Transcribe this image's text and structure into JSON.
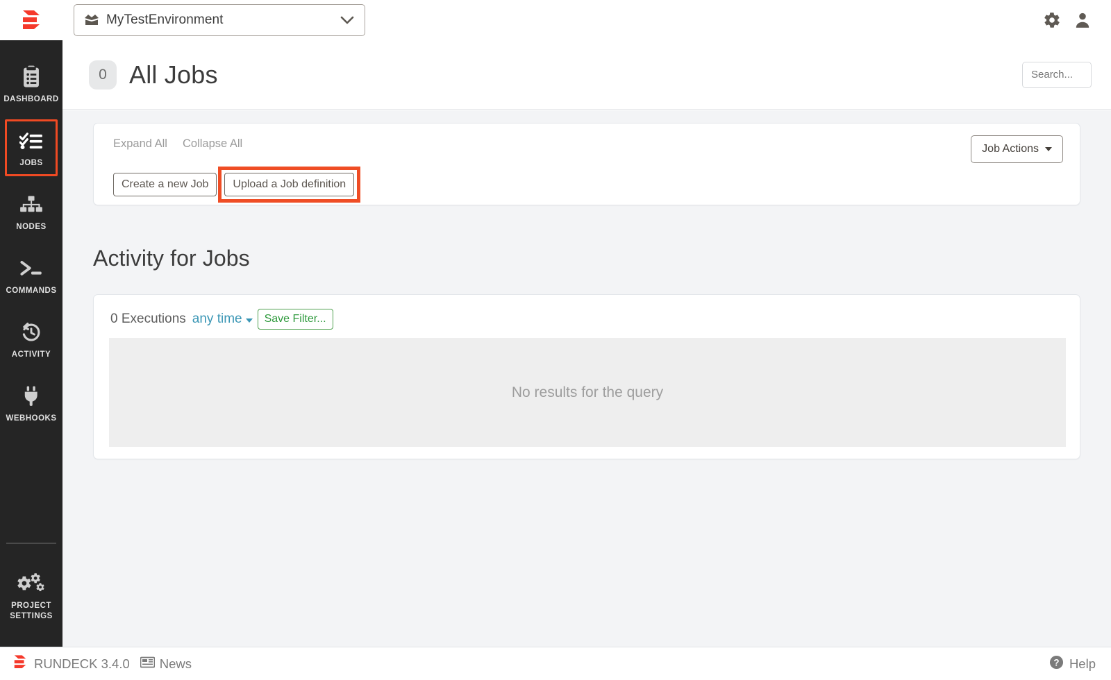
{
  "topbar": {
    "logo_icon": "rundeck-logo-icon",
    "project_selector": {
      "icon": "box-open-icon",
      "name": "MyTestEnvironment",
      "chevron_icon": "chevron-down-icon"
    },
    "gear_icon": "gear-icon",
    "user_icon": "user-icon"
  },
  "sidebar": {
    "items": [
      {
        "label": "DASHBOARD",
        "icon": "clipboard-list-icon",
        "highlighted": false
      },
      {
        "label": "JOBS",
        "icon": "checklist-icon",
        "highlighted": true
      },
      {
        "label": "NODES",
        "icon": "sitemap-icon",
        "highlighted": false
      },
      {
        "label": "COMMANDS",
        "icon": "terminal-prompt-icon",
        "highlighted": false
      },
      {
        "label": "ACTIVITY",
        "icon": "history-clock-icon",
        "highlighted": false
      },
      {
        "label": "WEBHOOKS",
        "icon": "plug-icon",
        "highlighted": false
      }
    ],
    "bottom_item": {
      "label": "PROJECT\nSETTINGS",
      "label_line1": "PROJECT",
      "label_line2": "SETTINGS",
      "icon": "cogs-icon"
    }
  },
  "header": {
    "count": "0",
    "title": "All Jobs",
    "search_placeholder": "Search...",
    "search_value": ""
  },
  "jobs_panel": {
    "expand_all": "Expand All",
    "collapse_all": "Collapse All",
    "create_job_label": "Create a new Job",
    "upload_job_label": "Upload a Job definition",
    "job_actions_label": "Job Actions",
    "job_actions_caret": "caret-down-icon"
  },
  "activity": {
    "section_title": "Activity for Jobs",
    "executions_count": "0 Executions",
    "time_filter": "any time",
    "time_filter_caret": "caret-down-icon",
    "save_filter_label": "Save Filter...",
    "empty_message": "No results for the query"
  },
  "footer": {
    "logo_icon": "rundeck-logo-icon",
    "product": "RUNDECK 3.4.0",
    "news_icon": "news-icon",
    "news_label": "News",
    "help_icon": "question-circle-icon",
    "help_label": "Help"
  },
  "colors": {
    "accent_red": "#f04a23",
    "sidebar_bg": "#252525",
    "content_bg": "#f3f4f6",
    "link_teal": "#3a96b5",
    "green": "#2f9a3d"
  }
}
